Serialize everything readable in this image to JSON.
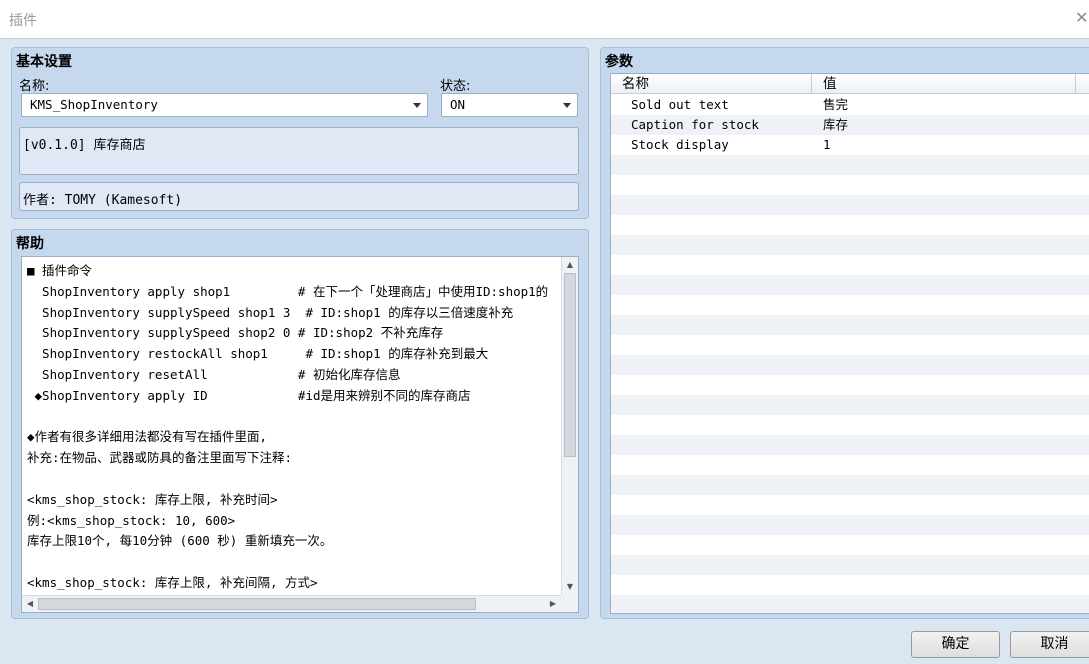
{
  "window": {
    "title": "插件",
    "close_glyph": "✕"
  },
  "basic": {
    "title": "基本设置",
    "name_label": "名称:",
    "name_value": "KMS_ShopInventory",
    "status_label": "状态:",
    "status_value": "ON",
    "description": "[v0.1.0] 库存商店",
    "author": "作者: TOMY (Kamesoft)"
  },
  "help": {
    "title": "帮助",
    "lines": [
      "■ 插件命令",
      "  ShopInventory apply shop1         # 在下一个「处理商店」中使用ID:shop1的",
      "  ShopInventory supplySpeed shop1 3  # ID:shop1 的库存以三倍速度补充",
      "  ShopInventory supplySpeed shop2 0 # ID:shop2 不补充库存",
      "  ShopInventory restockAll shop1     # ID:shop1 的库存补充到最大",
      "  ShopInventory resetAll            # 初始化库存信息",
      " ◆ShopInventory apply ID            #id是用来辨别不同的库存商店",
      "",
      "◆作者有很多详细用法都没有写在插件里面,",
      "补充:在物品、武器或防具的备注里面写下注释:",
      "",
      "<kms_shop_stock: 库存上限, 补充时间>",
      "例:<kms_shop_stock: 10, 600>",
      "库存上限10个, 每10分钟 (600 秒) 重新填充一次。",
      "",
      "<kms_shop_stock: 库存上限, 补充间隔, 方式>"
    ]
  },
  "params": {
    "title": "参数",
    "col_name": "名称",
    "col_value": "值",
    "rows": [
      {
        "name": "Sold out text",
        "value": "售完"
      },
      {
        "name": "Caption for stock",
        "value": "库存"
      },
      {
        "name": "Stock display",
        "value": "1"
      }
    ]
  },
  "buttons": {
    "ok": "确定",
    "cancel": "取消"
  }
}
